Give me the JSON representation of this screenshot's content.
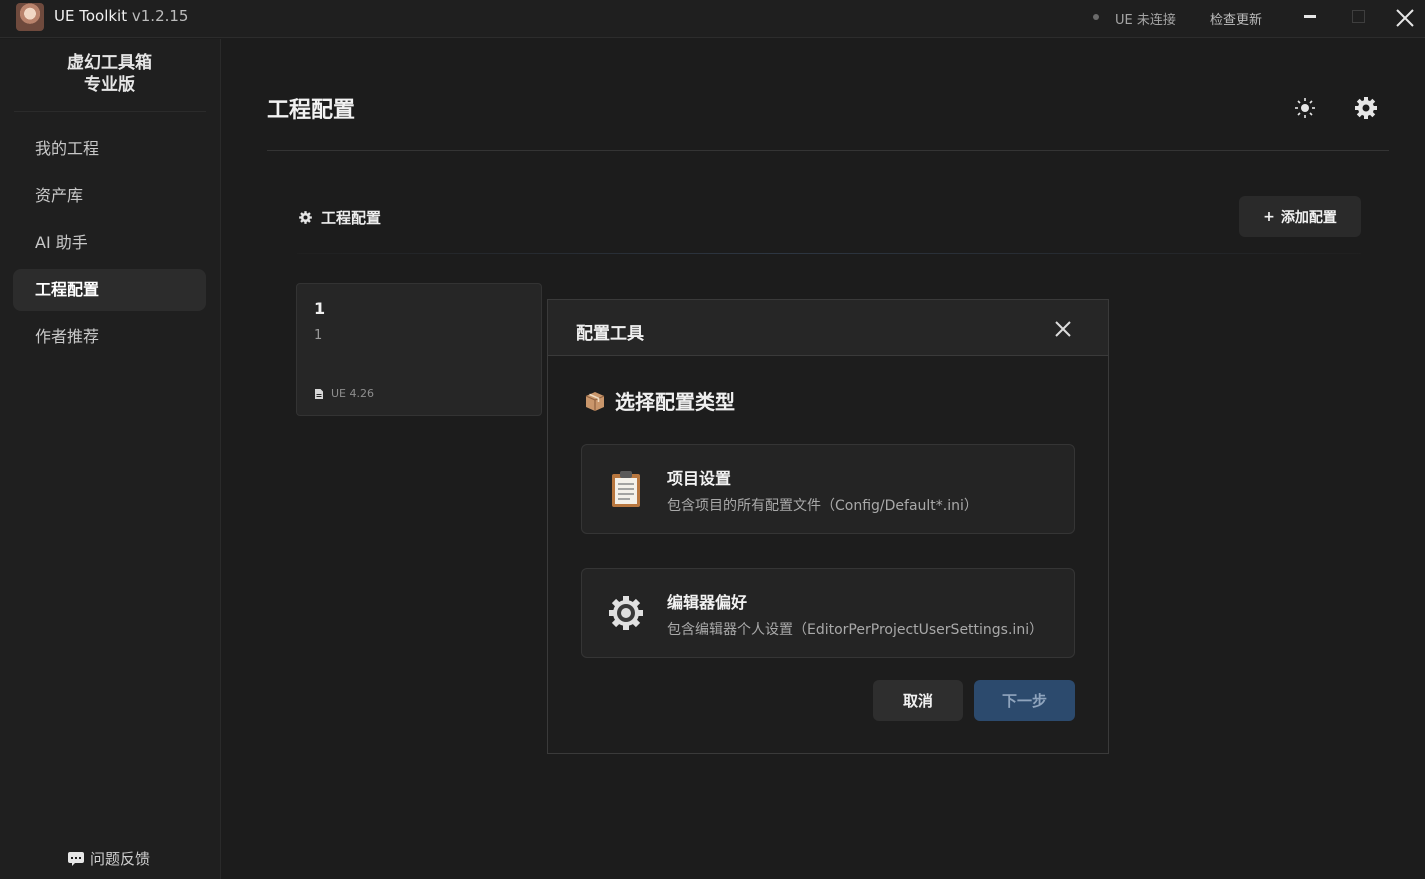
{
  "titlebar": {
    "app_name": "UE Toolkit",
    "version": "v1.2.15",
    "status": "UE 未连接",
    "check_update": "检查更新"
  },
  "sidebar": {
    "brand_line1": "虚幻工具箱",
    "brand_line2": "专业版",
    "items": [
      {
        "label": "我的工程"
      },
      {
        "label": "资产库"
      },
      {
        "label": "AI 助手"
      },
      {
        "label": "工程配置"
      },
      {
        "label": "作者推荐"
      }
    ],
    "active_item": "工程配置",
    "feedback": "问题反馈"
  },
  "main": {
    "page_title": "工程配置",
    "section_title": "工程配置",
    "add_button": "添加配置",
    "config_card": {
      "name": "1",
      "description": "1",
      "engine_version": "UE 4.26"
    }
  },
  "modal": {
    "title": "配置工具",
    "subtitle": "选择配置类型",
    "options": [
      {
        "title": "项目设置",
        "description": "包含项目的所有配置文件（Config/Default*.ini）",
        "icon": "clipboard-icon"
      },
      {
        "title": "编辑器偏好",
        "description": "包含编辑器个人设置（EditorPerProjectUserSettings.ini）",
        "icon": "gear-icon"
      }
    ],
    "cancel_label": "取消",
    "next_label": "下一步"
  },
  "colors": {
    "background": "#1c1c1c",
    "sidebar": "#1f1f1f",
    "active_nav": "#2c2c2c",
    "primary_button": "#2c4a6d"
  }
}
